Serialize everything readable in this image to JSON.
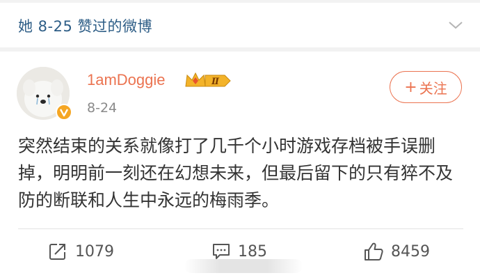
{
  "header": {
    "title": "她 8-25 赞过的微博",
    "chevron_icon": "chevron-down-icon"
  },
  "post": {
    "username": "1amDoggie",
    "member_badge": "Ⅱ",
    "date": "8-24",
    "follow_label": "关注",
    "follow_prefix": "+",
    "text": "突然结束的关系就像打了几千个小时游戏存档被手误删掉，明明前一刻还在幻想未来，但最后留下的只有猝不及防的断联和人生中永远的梅雨季。"
  },
  "actions": {
    "repost_count": "1079",
    "comment_count": "185",
    "like_count": "8459"
  },
  "colors": {
    "header_title": "#2d5d86",
    "username": "#eb7350",
    "follow": "#eb7350",
    "text": "#333333",
    "muted": "#8a8a8a",
    "background": "#f2f2f2"
  }
}
